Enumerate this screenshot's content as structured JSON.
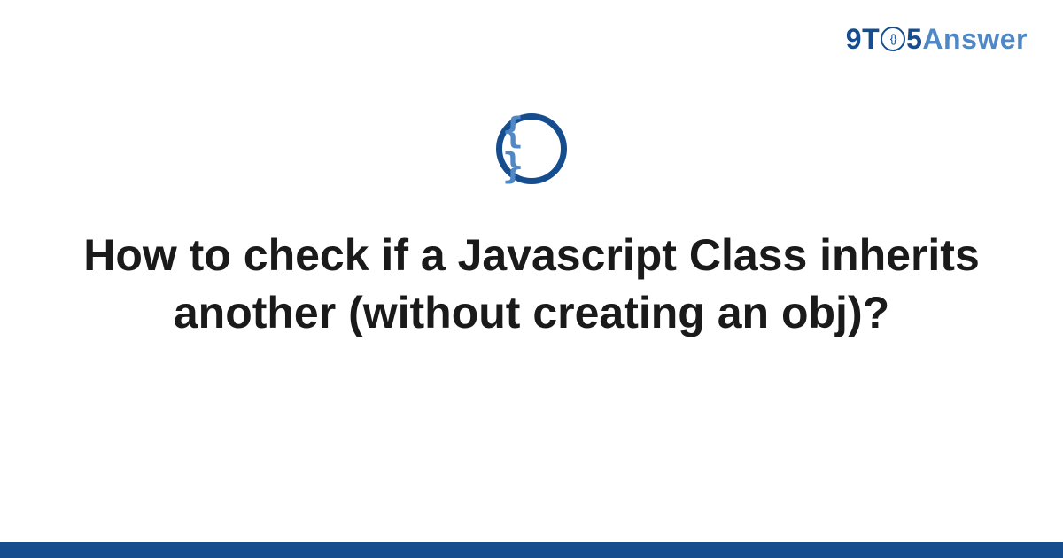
{
  "logo": {
    "part1": "9T",
    "circle_inner": "{}",
    "part2": "5",
    "part3": "Answer"
  },
  "icon": {
    "braces": "{ }"
  },
  "title": "How to check if a Javascript Class inherits another (without creating an obj)?"
}
